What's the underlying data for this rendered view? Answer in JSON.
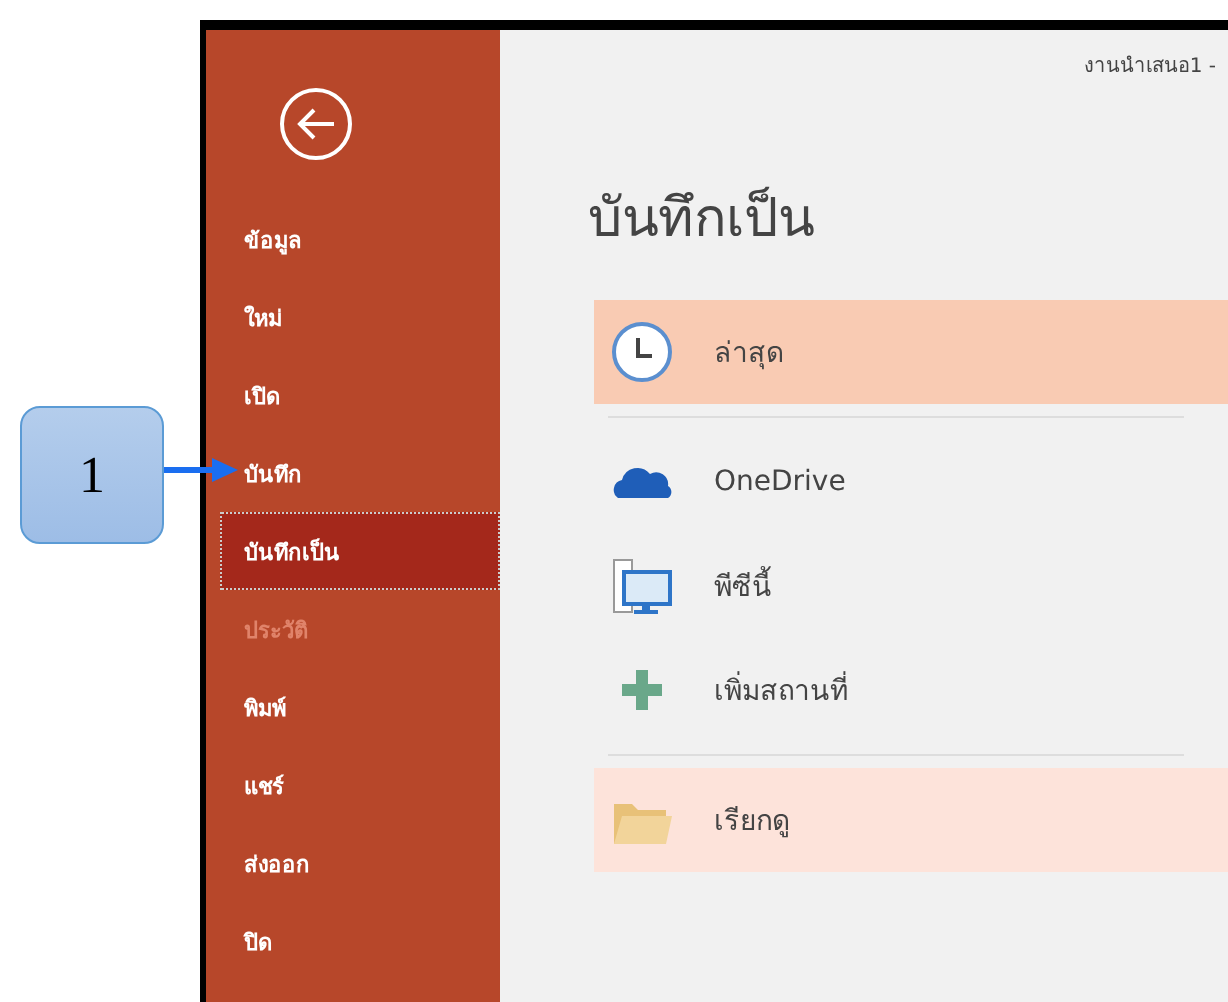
{
  "callout": {
    "label": "1"
  },
  "window": {
    "title": "งานนำเสนอ1 -"
  },
  "sidebar": {
    "items": [
      {
        "label": "ข้อมูล",
        "selected": false,
        "disabled": false
      },
      {
        "label": "ใหม่",
        "selected": false,
        "disabled": false
      },
      {
        "label": "เปิด",
        "selected": false,
        "disabled": false
      },
      {
        "label": "บันทึก",
        "selected": false,
        "disabled": false
      },
      {
        "label": "บันทึกเป็น",
        "selected": true,
        "disabled": false
      },
      {
        "label": "ประวัติ",
        "selected": false,
        "disabled": true
      },
      {
        "label": "พิมพ์",
        "selected": false,
        "disabled": false
      },
      {
        "label": "แชร์",
        "selected": false,
        "disabled": false
      },
      {
        "label": "ส่งออก",
        "selected": false,
        "disabled": false
      },
      {
        "label": "ปิด",
        "selected": false,
        "disabled": false
      }
    ]
  },
  "heading": "บันทึกเป็น",
  "places": [
    {
      "kind": "recent",
      "label": "ล่าสุด",
      "selected": true,
      "highlighted": false
    },
    {
      "kind": "onedrive",
      "label": "OneDrive",
      "selected": false,
      "highlighted": false
    },
    {
      "kind": "pc",
      "label": "พีซีนี้",
      "selected": false,
      "highlighted": false
    },
    {
      "kind": "add",
      "label": "เพิ่มสถานที่",
      "selected": false,
      "highlighted": false
    },
    {
      "kind": "browse",
      "label": "เรียกดู",
      "selected": false,
      "highlighted": true
    }
  ]
}
